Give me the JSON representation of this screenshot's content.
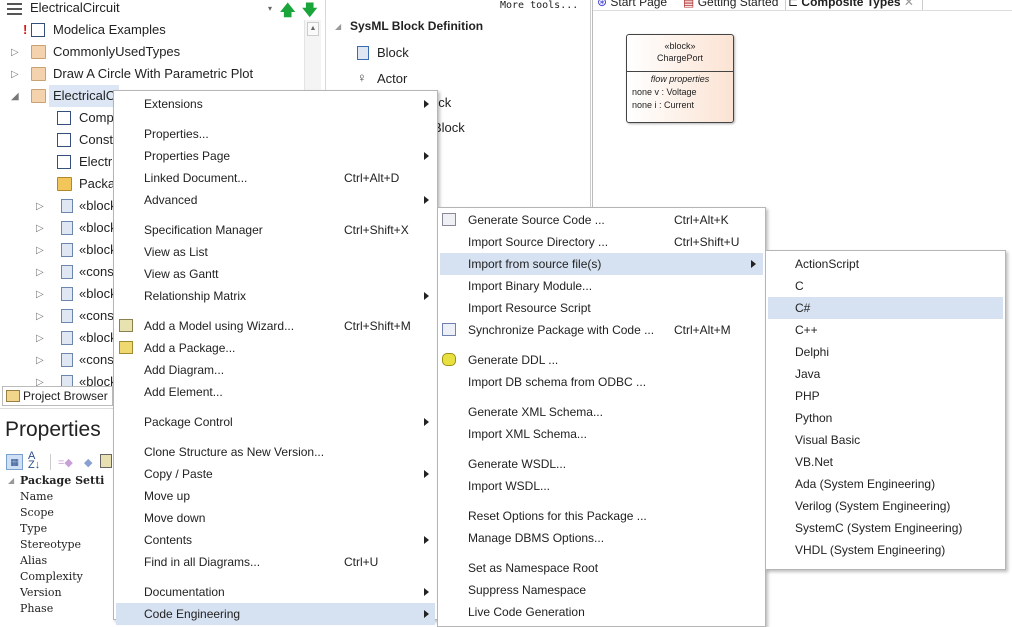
{
  "tree": {
    "title": "ElectricalCircuit",
    "rows": [
      {
        "label": "Modelica Examples",
        "icon": "diagram-icon",
        "warning": "!"
      },
      {
        "label": "CommonlyUsedTypes",
        "icon": "folder-icon",
        "expander": "collapsed"
      },
      {
        "label": "Draw A Circle With Parametric Plot",
        "icon": "folder-icon",
        "expander": "collapsed"
      },
      {
        "label": "ElectricalC",
        "icon": "folder-open-icon",
        "expander": "expanded",
        "selected": true
      },
      {
        "label": "Comp",
        "icon": "diagram-icon",
        "indent": 1
      },
      {
        "label": "Const",
        "icon": "diagram-icon",
        "indent": 1
      },
      {
        "label": "Electri",
        "icon": "diagram-icon",
        "indent": 1
      },
      {
        "label": "Packa",
        "icon": "package-icon",
        "indent": 1
      },
      {
        "label": "«block",
        "icon": "block-icon",
        "indent": 1,
        "expander": "collapsed"
      },
      {
        "label": "«block",
        "icon": "block-icon",
        "indent": 1,
        "expander": "collapsed"
      },
      {
        "label": "«block",
        "icon": "block-icon",
        "indent": 1,
        "expander": "collapsed"
      },
      {
        "label": "«cons",
        "icon": "block-icon",
        "indent": 1,
        "expander": "collapsed"
      },
      {
        "label": "«block",
        "icon": "block-icon",
        "indent": 1,
        "expander": "collapsed"
      },
      {
        "label": "«cons",
        "icon": "block-icon",
        "indent": 1,
        "expander": "collapsed"
      },
      {
        "label": "«block",
        "icon": "block-icon",
        "indent": 1,
        "expander": "collapsed"
      },
      {
        "label": "«cons",
        "icon": "block-icon",
        "indent": 1,
        "expander": "collapsed"
      },
      {
        "label": "«block",
        "icon": "block-icon",
        "indent": 1,
        "expander": "collapsed"
      }
    ],
    "project_browser_tab": "Project Browser"
  },
  "properties": {
    "title": "Properties",
    "section": "Package Setti",
    "fields": [
      "Name",
      "Scope",
      "Type",
      "Stereotype",
      "Alias",
      "Complexity",
      "Version",
      "Phase"
    ]
  },
  "toolbox": {
    "more_tools": "More tools...",
    "section": "SysML Block Definition",
    "items": [
      "Block",
      "Actor"
    ],
    "hidden_fragments": [
      "ock",
      "Block",
      "n"
    ]
  },
  "diagram": {
    "tabs": [
      "Start Page",
      "Getting Started",
      "Composite Types"
    ],
    "active_tab": "Composite Types",
    "block": {
      "stereotype": "«block»",
      "name": "ChargePort",
      "compartment": "flow properties",
      "props": [
        "none v : Voltage",
        "none i : Current"
      ]
    }
  },
  "context_menu": [
    {
      "label": "Extensions",
      "submenu": true
    },
    {
      "sep": true
    },
    {
      "label": "Properties..."
    },
    {
      "label": "Properties Page",
      "submenu": true
    },
    {
      "label": "Linked Document...",
      "shortcut": "Ctrl+Alt+D"
    },
    {
      "label": "Advanced",
      "submenu": true
    },
    {
      "sep": true
    },
    {
      "label": "Specification Manager",
      "shortcut": "Ctrl+Shift+X"
    },
    {
      "label": "View as List"
    },
    {
      "label": "View as Gantt"
    },
    {
      "label": "Relationship Matrix",
      "submenu": true
    },
    {
      "sep": true
    },
    {
      "label": "Add a Model using Wizard...",
      "shortcut": "Ctrl+Shift+M",
      "icon": "wizard-icon"
    },
    {
      "label": "Add a Package...",
      "icon": "folder-add-icon"
    },
    {
      "label": "Add Diagram..."
    },
    {
      "label": "Add Element..."
    },
    {
      "sep": true
    },
    {
      "label": "Package Control",
      "submenu": true
    },
    {
      "sep": true
    },
    {
      "label": "Clone Structure as New Version..."
    },
    {
      "label": "Copy / Paste",
      "submenu": true
    },
    {
      "label": "Move up"
    },
    {
      "label": "Move down"
    },
    {
      "label": "Contents",
      "submenu": true
    },
    {
      "label": "Find in all Diagrams...",
      "shortcut": "Ctrl+U"
    },
    {
      "sep": true
    },
    {
      "label": "Documentation",
      "submenu": true
    },
    {
      "label": "Code Engineering",
      "submenu": true,
      "highlighted": true
    }
  ],
  "code_engineering_menu": [
    {
      "label": "Generate Source Code ...",
      "shortcut": "Ctrl+Alt+K",
      "icon": "generate-code-icon"
    },
    {
      "label": "Import Source Directory ...",
      "shortcut": "Ctrl+Shift+U"
    },
    {
      "label": "Import from source file(s)",
      "submenu": true,
      "highlighted": true
    },
    {
      "label": "Import Binary Module..."
    },
    {
      "label": "Import Resource Script"
    },
    {
      "label": "Synchronize Package with Code ...",
      "shortcut": "Ctrl+Alt+M",
      "icon": "sync-icon"
    },
    {
      "sep": true
    },
    {
      "label": "Generate DDL ...",
      "icon": "database-icon"
    },
    {
      "label": "Import DB schema from ODBC ..."
    },
    {
      "sep": true
    },
    {
      "label": "Generate XML Schema..."
    },
    {
      "label": "Import XML Schema..."
    },
    {
      "sep": true
    },
    {
      "label": "Generate WSDL..."
    },
    {
      "label": "Import WSDL..."
    },
    {
      "sep": true
    },
    {
      "label": "Reset Options for this Package ..."
    },
    {
      "label": "Manage DBMS Options..."
    },
    {
      "sep": true
    },
    {
      "label": "Set as Namespace Root"
    },
    {
      "label": "Suppress Namespace"
    },
    {
      "label": "Live Code Generation"
    }
  ],
  "language_menu": [
    {
      "label": "ActionScript"
    },
    {
      "label": "C"
    },
    {
      "label": "C#",
      "highlighted": true
    },
    {
      "label": "C++"
    },
    {
      "label": "Delphi"
    },
    {
      "label": "Java"
    },
    {
      "label": "PHP"
    },
    {
      "label": "Python"
    },
    {
      "label": "Visual Basic"
    },
    {
      "label": "VB.Net"
    },
    {
      "label": "Ada (System Engineering)"
    },
    {
      "label": "Verilog (System Engineering)"
    },
    {
      "label": "SystemC (System Engineering)"
    },
    {
      "label": "VHDL (System Engineering)"
    }
  ],
  "colors": {
    "highlight": "#d6e1f1",
    "arrow_green": "#1aa53a",
    "block_fill": "#fbe3d3"
  }
}
